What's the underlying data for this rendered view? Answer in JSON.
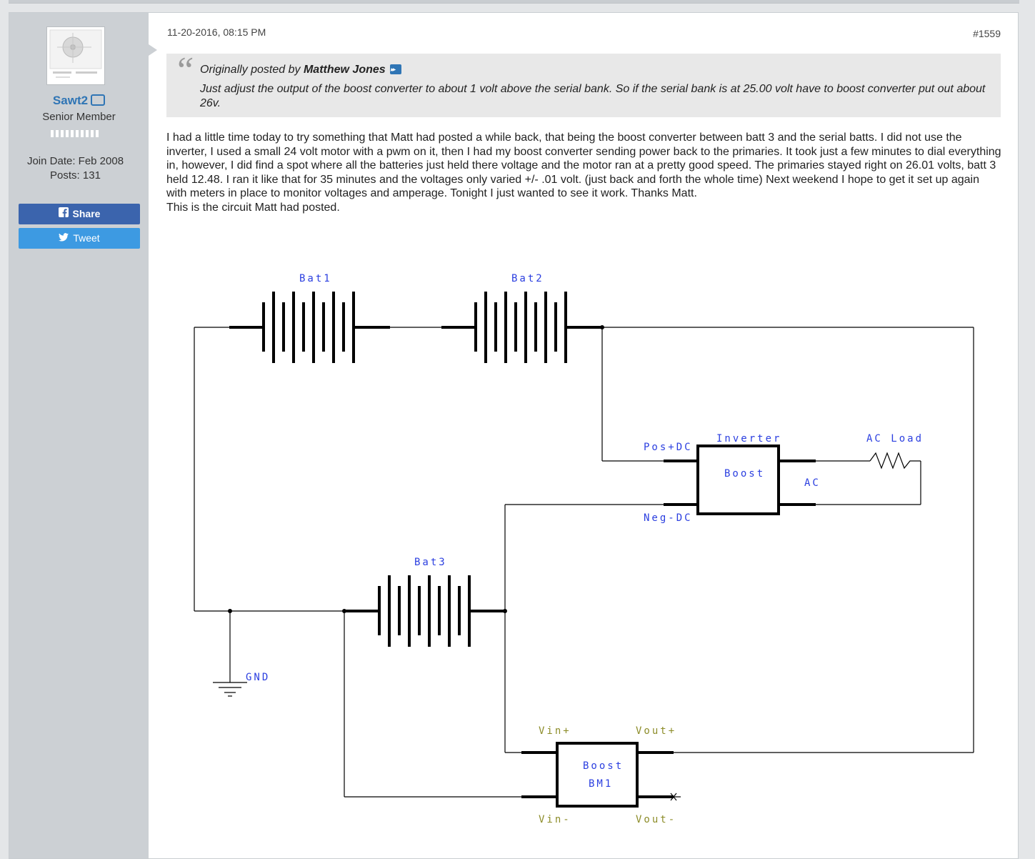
{
  "user": {
    "name": "Sawt2",
    "title": "Senior Member",
    "join_date": "Join Date: Feb 2008",
    "posts": "Posts: 131"
  },
  "social": {
    "share_label": "Share",
    "tweet_label": "Tweet"
  },
  "post": {
    "date": "11-20-2016, 08:15 PM",
    "number": "#1559",
    "quote": {
      "prefix": "Originally posted by ",
      "author": "Matthew Jones",
      "text": "Just adjust the output of the boost converter to about 1 volt above the serial bank. So if the serial bank is at 25.00 volt have to boost converter put out about 26v."
    },
    "body": "I had a little time today to try something that Matt had posted a while back, that being the boost converter between batt 3 and the serial batts. I did not use the inverter, I used a small 24 volt motor with a pwm on it, then I had my boost converter sending power back to the primaries. It took just a few minutes to dial everything in, however, I did find a spot where all the batteries just held there voltage and the motor ran at a pretty good speed. The primaries stayed right on 26.01 volts, batt 3 held 12.48. I ran it like that for 35 minutes and the voltages only varied +/- .01 volt. (just back and forth the whole time) Next weekend I hope to get it set up again with meters in place to monitor voltages and amperage. Tonight I just wanted to see it work. Thanks Matt.",
    "body_line2": "This is the circuit Matt had posted."
  },
  "schematic": {
    "bat1": "Bat1",
    "bat2": "Bat2",
    "bat3": "Bat3",
    "inverter_label": "Inverter",
    "inverter_box": "Boost",
    "pos_dc": "Pos+DC",
    "neg_dc": "Neg-DC",
    "ac": "AC",
    "ac_load": "AC Load",
    "gnd": "GND",
    "vin_plus": "Vin+",
    "vout_plus": "Vout+",
    "vin_minus": "Vin-",
    "vout_minus": "Vout-",
    "boost_box_line1": "Boost",
    "boost_box_line2": "BM1"
  },
  "colors": {
    "username": "#2f75b5",
    "share": "#3b64ad",
    "tweet": "#3d9ae2",
    "schematic_label": "#2b3fe0",
    "schematic_pin_label": "#8d8d2a"
  }
}
